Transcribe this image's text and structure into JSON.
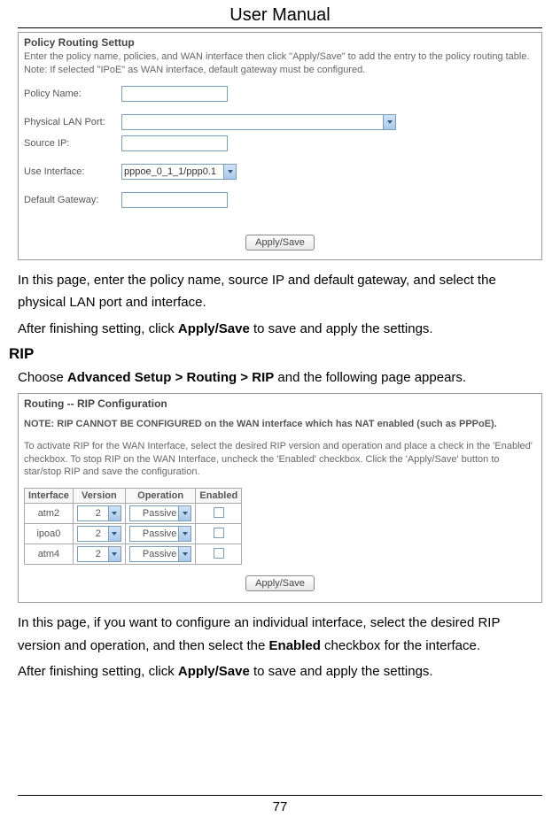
{
  "header": "User Manual",
  "page_number": "77",
  "policy_panel": {
    "title": "Policy Routing Settup",
    "description": "Enter the policy name, policies, and WAN interface then click \"Apply/Save\" to add the entry to the policy routing table. Note: If selected \"IPoE\" as WAN interface, default gateway must be configured.",
    "labels": {
      "policy_name": "Policy Name:",
      "physical_lan_port": "Physical LAN Port:",
      "source_ip": "Source IP:",
      "use_interface": "Use Interface:",
      "default_gateway": "Default Gateway:"
    },
    "use_interface_value": "pppoe_0_1_1/ppp0.1",
    "apply_button": "Apply/Save"
  },
  "policy_text1": "In this page, enter the policy name, source IP and default gateway, and select the physical LAN port and interface.",
  "policy_text2_prefix": "After finishing setting, click ",
  "policy_text2_bold": "Apply/Save",
  "policy_text2_suffix": " to save and apply the settings.",
  "rip_heading": "RIP",
  "rip_choose_prefix": "Choose ",
  "rip_choose_bold": "Advanced Setup > Routing > RIP",
  "rip_choose_suffix": " and the following page appears.",
  "rip_panel": {
    "title": "Routing -- RIP Configuration",
    "note_bold": "NOTE: RIP CANNOT BE CONFIGURED on the WAN interface which has NAT enabled (such as PPPoE).",
    "description": "To activate RIP for the WAN Interface, select the desired RIP version and operation and place a check in the 'Enabled' checkbox. To stop RIP on the WAN Interface, uncheck the 'Enabled' checkbox. Click the 'Apply/Save' button to star/stop RIP and save the configuration.",
    "headers": {
      "interface": "Interface",
      "version": "Version",
      "operation": "Operation",
      "enabled": "Enabled"
    },
    "rows": [
      {
        "interface": "atm2",
        "version": "2",
        "operation": "Passive"
      },
      {
        "interface": "ipoa0",
        "version": "2",
        "operation": "Passive"
      },
      {
        "interface": "atm4",
        "version": "2",
        "operation": "Passive"
      }
    ],
    "apply_button": "Apply/Save"
  },
  "rip_text1_prefix": "In this page, if you want to configure an individual interface, select the desired RIP version and operation, and then select the ",
  "rip_text1_bold": "Enabled",
  "rip_text1_suffix": " checkbox for the interface.",
  "rip_text2_prefix": "After finishing setting, click ",
  "rip_text2_bold": "Apply/Save",
  "rip_text2_suffix": " to save and apply the settings."
}
